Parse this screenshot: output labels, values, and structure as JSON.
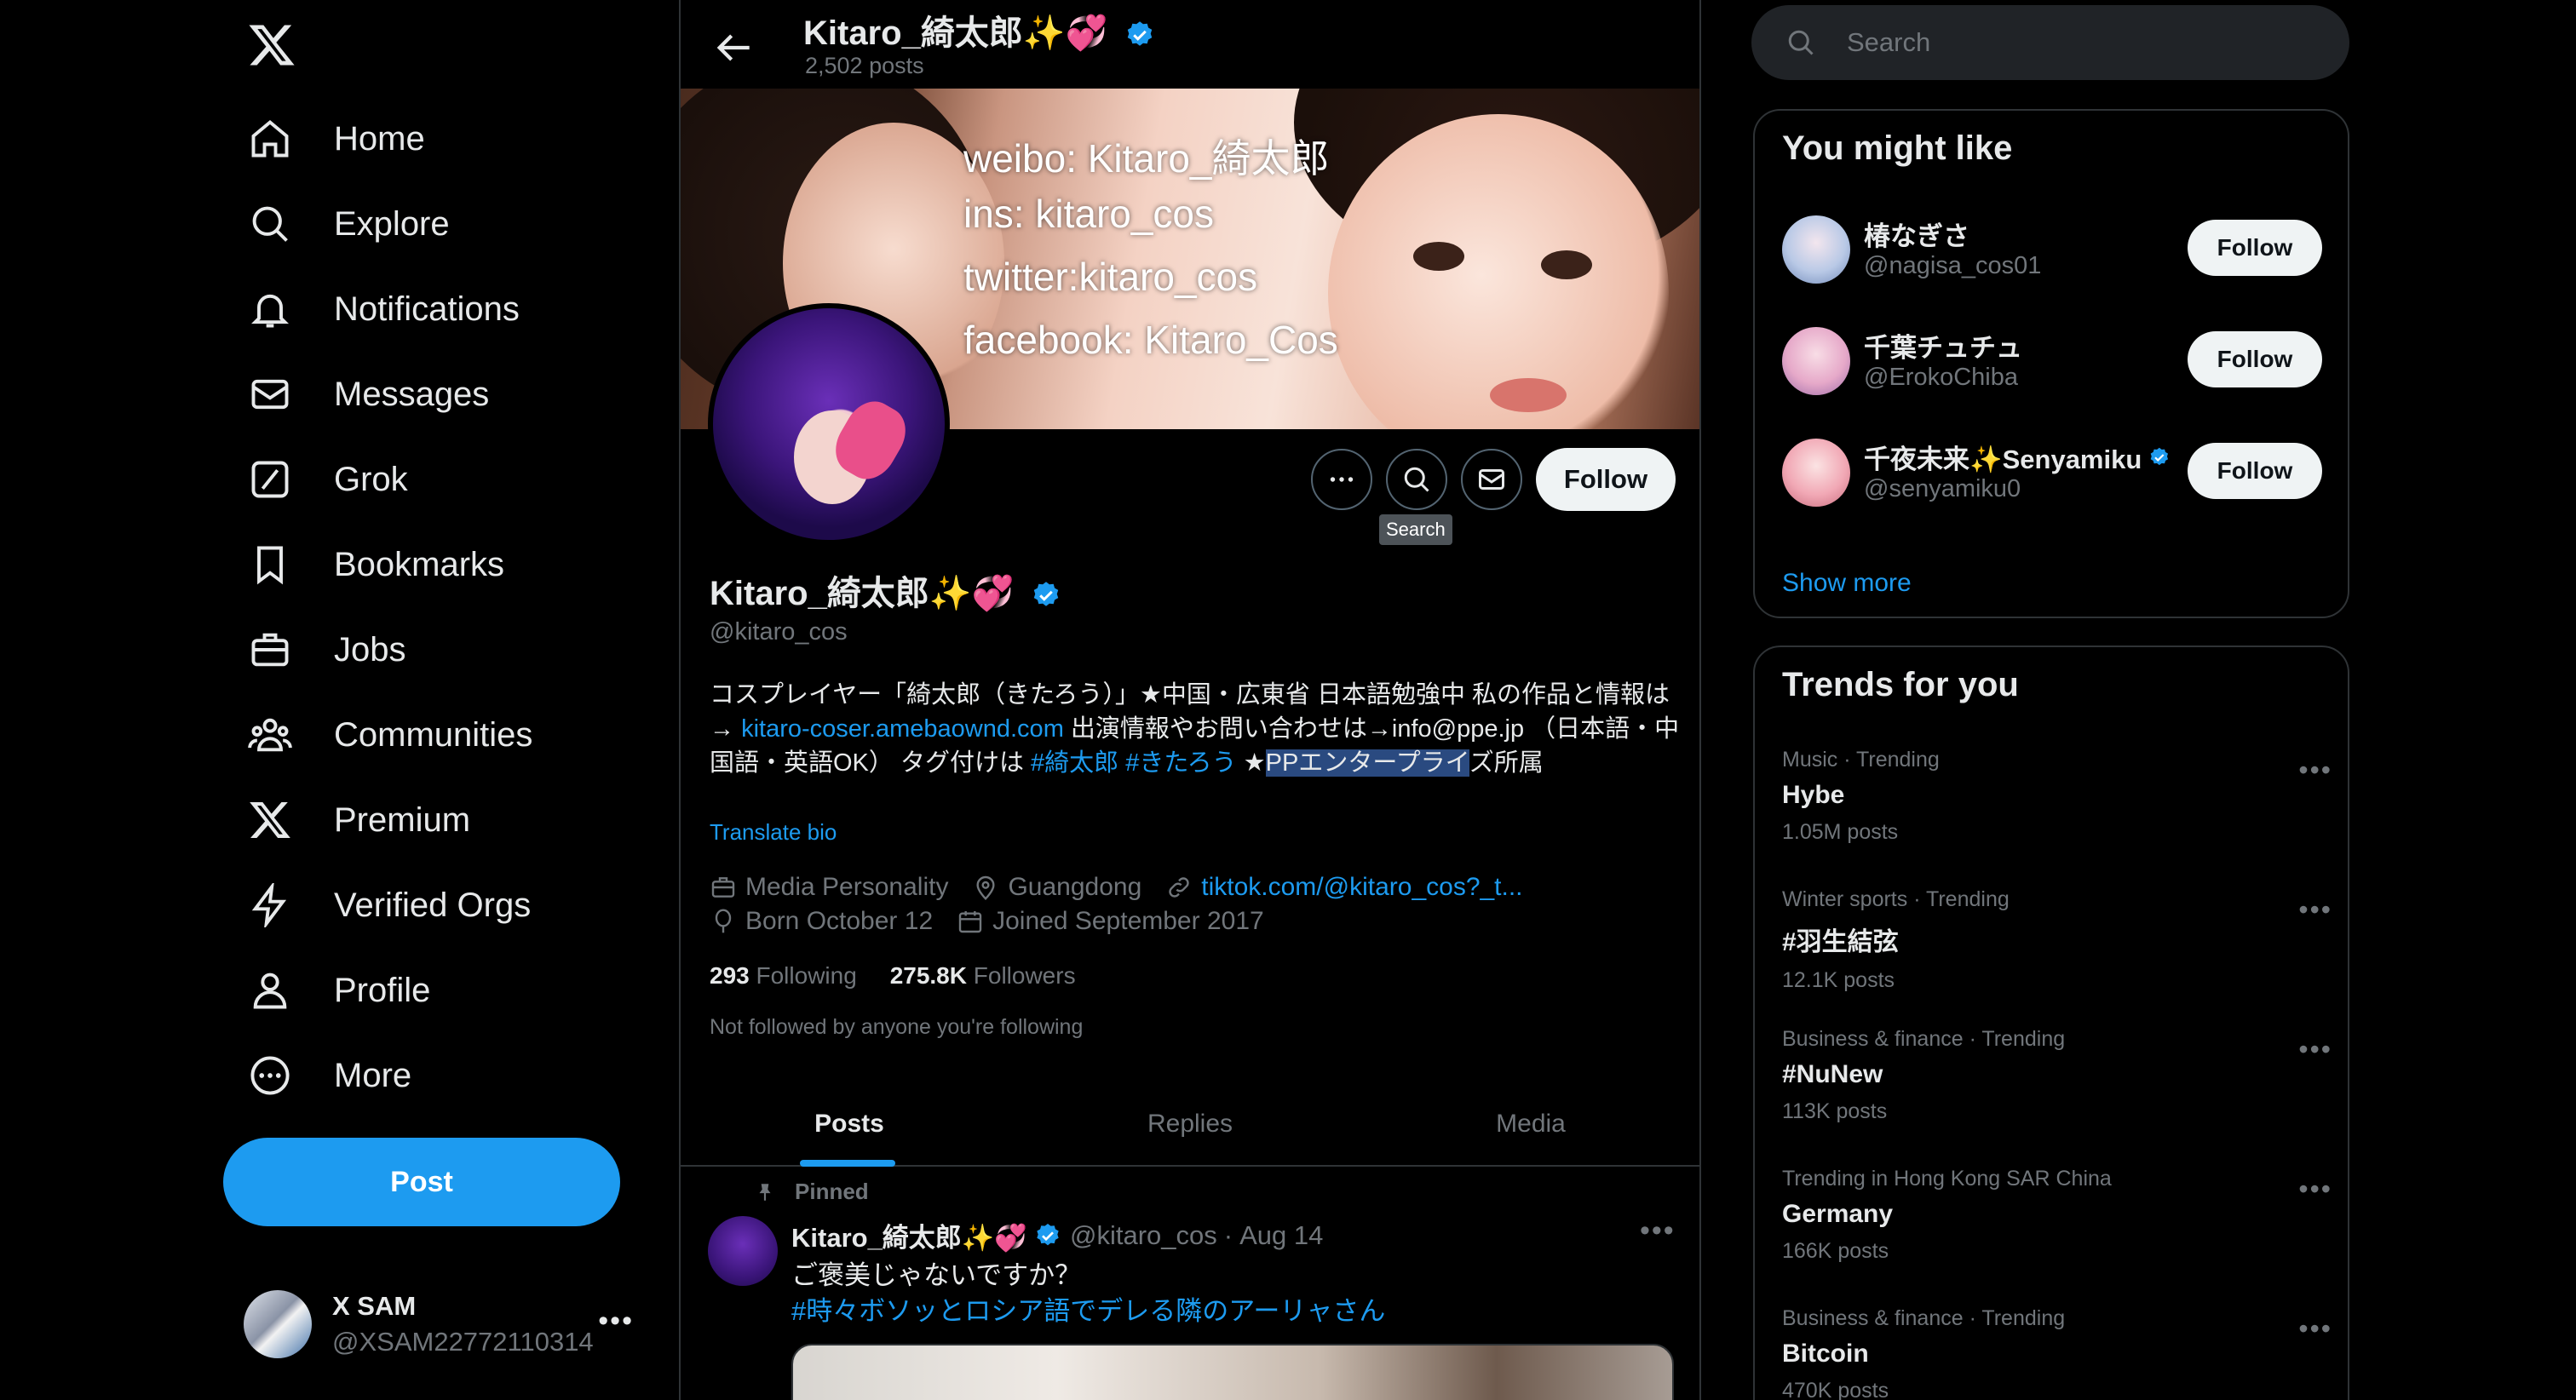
{
  "nav": {
    "items": [
      {
        "label": "Home",
        "icon": "home-icon"
      },
      {
        "label": "Explore",
        "icon": "search-icon"
      },
      {
        "label": "Notifications",
        "icon": "bell-icon"
      },
      {
        "label": "Messages",
        "icon": "mail-icon"
      },
      {
        "label": "Grok",
        "icon": "grok-icon"
      },
      {
        "label": "Bookmarks",
        "icon": "bookmark-icon"
      },
      {
        "label": "Jobs",
        "icon": "briefcase-icon"
      },
      {
        "label": "Communities",
        "icon": "people-icon"
      },
      {
        "label": "Premium",
        "icon": "x-icon"
      },
      {
        "label": "Verified Orgs",
        "icon": "lightning-icon"
      },
      {
        "label": "Profile",
        "icon": "person-icon"
      },
      {
        "label": "More",
        "icon": "more-circle-icon"
      }
    ],
    "post_label": "Post"
  },
  "account": {
    "name": "X SAM",
    "handle": "@XSAM22772110314"
  },
  "header": {
    "name": "Kitaro_綺太郎✨💞",
    "posts": "2,502 posts"
  },
  "banner": {
    "lines": [
      "weibo: Kitaro_綺太郎",
      "ins: kitaro_cos",
      "twitter:kitaro_cos",
      "facebook: Kitaro_Cos"
    ]
  },
  "profile": {
    "name": "Kitaro_綺太郎✨💞",
    "handle": "@kitaro_cos",
    "follow_label": "Follow",
    "tooltip": "Search",
    "bio": {
      "part1": "コスプレイヤー「綺太郎（きたろう）」★中国・広東省 日本語勉強中 私の作品と情報は→ ",
      "link": "kitaro-coser.amebaownd.com",
      "part2": " 出演情報やお問い合わせは→info@ppe.jp （日本語・中国語・英語OK） タグ付けは ",
      "tag1": "#綺太郎",
      "tag2": "#きたろう",
      "part3": " ★",
      "selected": "PPエンタープライ",
      "part4": "ズ所属"
    },
    "translate": "Translate bio",
    "category": "Media Personality",
    "location": "Guangdong",
    "website": "tiktok.com/@kitaro_cos?_t...",
    "born": "Born October 12",
    "joined": "Joined September 2017",
    "following_count": "293",
    "following_label": "Following",
    "followers_count": "275.8K",
    "followers_label": "Followers",
    "not_followed": "Not followed by anyone you're following"
  },
  "tabs": [
    "Posts",
    "Replies",
    "Media"
  ],
  "pinned_tweet": {
    "pinned_label": "Pinned",
    "name": "Kitaro_綺太郎✨💞",
    "handle": "@kitaro_cos",
    "date": "Aug 14",
    "text": "ご褒美じゃないですか？",
    "tags": "#時々ボソッとロシア語でデレる隣のアーリャさん"
  },
  "search": {
    "placeholder": "Search"
  },
  "suggestions": {
    "title": "You might like",
    "items": [
      {
        "name": "椿なぎさ",
        "handle": "@nagisa_cos01",
        "follow": "Follow"
      },
      {
        "name": "千葉チュチュ",
        "handle": "@ErokoChiba",
        "follow": "Follow"
      },
      {
        "name": "千夜未来✨Senyamiku",
        "handle": "@senyamiku0",
        "follow": "Follow"
      }
    ],
    "show_more": "Show more"
  },
  "trends": {
    "title": "Trends for you",
    "items": [
      {
        "context": "Music · Trending",
        "topic": "Hybe",
        "count": "1.05M posts"
      },
      {
        "context": "Winter sports · Trending",
        "topic": "#羽生結弦",
        "count": "12.1K posts"
      },
      {
        "context": "Business & finance · Trending",
        "topic": "#NuNew",
        "count": "113K posts"
      },
      {
        "context": "Trending in Hong Kong SAR China",
        "topic": "Germany",
        "count": "166K posts"
      },
      {
        "context": "Business & finance · Trending",
        "topic": "Bitcoin",
        "count": "470K posts"
      }
    ]
  },
  "colors": {
    "accent": "#1d9bf0",
    "background": "#000000",
    "border": "#2f3336",
    "muted": "#71767b",
    "selection": "#2a4a80"
  }
}
